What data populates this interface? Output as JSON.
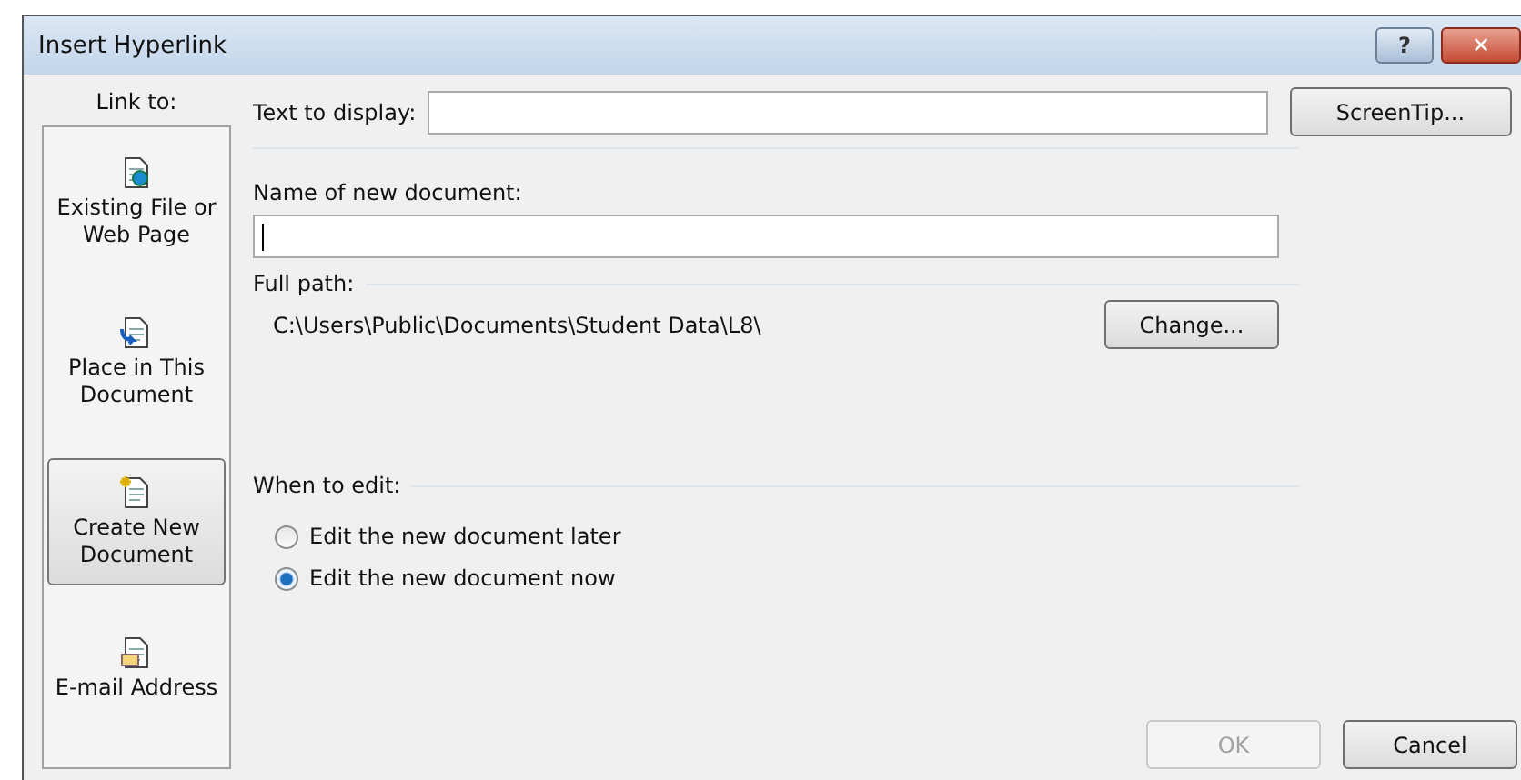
{
  "window": {
    "title": "Insert Hyperlink",
    "title_buttons": [
      {
        "kind": "help",
        "label": "?"
      },
      {
        "kind": "close",
        "label": "✕"
      }
    ]
  },
  "link_to": {
    "label": "Link to:",
    "items": [
      {
        "kind": "file",
        "label": "Existing File or Web Page",
        "selected": false
      },
      {
        "kind": "place",
        "label": "Place in This Document",
        "selected": false
      },
      {
        "kind": "new",
        "label": "Create New Document",
        "selected": true
      },
      {
        "kind": "email",
        "label": "E-mail Address",
        "selected": false
      }
    ]
  },
  "text_to_display": {
    "label": "Text to display:"
  },
  "screentip_button": "ScreenTip...",
  "name_of_new_document": {
    "label": "Name of new document:",
    "focused": true
  },
  "full_path": {
    "label": "Full path:",
    "value": "C:\\Users\\Public\\Documents\\Student Data\\L8\\"
  },
  "change_button": "Change...",
  "when_to_edit": {
    "label": "When to edit:",
    "options": [
      {
        "label": "Edit the new document later",
        "selected": false
      },
      {
        "label": "Edit the new document now",
        "selected": true
      }
    ]
  },
  "buttons": [
    {
      "label": "OK",
      "disabled": true
    },
    {
      "label": "Cancel",
      "disabled": false
    }
  ]
}
